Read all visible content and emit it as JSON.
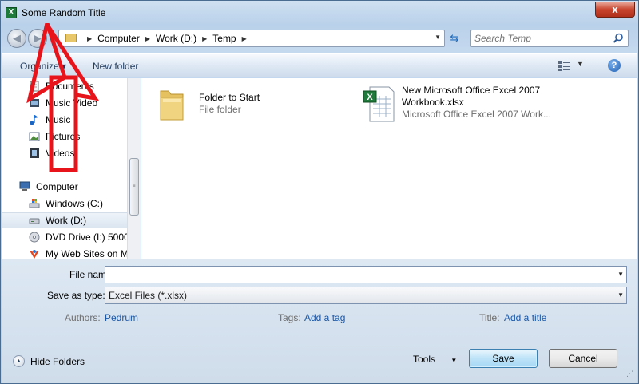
{
  "window": {
    "title": "Some Random Title",
    "close_glyph": "x"
  },
  "address": {
    "crumbs": [
      "Computer",
      "Work (D:)",
      "Temp"
    ],
    "search_placeholder": "Search Temp"
  },
  "toolbar": {
    "organize_label": "Organize ▾",
    "new_folder_label": "New folder",
    "help_glyph": "?"
  },
  "sidebar": {
    "items": [
      {
        "label": "Documents",
        "icon": "documents-icon"
      },
      {
        "label": "Music Video",
        "icon": "video-icon"
      },
      {
        "label": "Music",
        "icon": "music-icon"
      },
      {
        "label": "Pictures",
        "icon": "pictures-icon"
      },
      {
        "label": "Videos",
        "icon": "videos-icon"
      },
      {
        "label": "Computer",
        "icon": "computer-icon"
      },
      {
        "label": "Windows (C:)",
        "icon": "windows-drive-icon"
      },
      {
        "label": "Work (D:)",
        "icon": "drive-icon"
      },
      {
        "label": "DVD Drive (I:) 5000",
        "icon": "dvd-icon"
      },
      {
        "label": "My Web Sites on M",
        "icon": "web-sites-icon"
      }
    ],
    "selected": "Work (D:)"
  },
  "files": [
    {
      "name": "Folder to Start",
      "type": "File folder",
      "icon": "folder-icon"
    },
    {
      "name_line1": "New Microsoft Office Excel 2007",
      "name_line2": "Workbook.xlsx",
      "type": "Microsoft Office Excel 2007 Work...",
      "icon": "excel-file-icon"
    }
  ],
  "form": {
    "file_name_label": "File name:",
    "file_name_value": "",
    "save_type_label": "Save as type:",
    "save_type_value": "Excel Files (*.xlsx)",
    "authors_label": "Authors:",
    "authors_value": "Pedrum",
    "tags_label": "Tags:",
    "tags_value": "Add a tag",
    "title_label": "Title:",
    "title_value": "Add a title"
  },
  "footer": {
    "hide_folders_label": "Hide Folders",
    "tools_label": "Tools",
    "save_label": "Save",
    "cancel_label": "Cancel"
  },
  "colors": {
    "annotation": "#e8141c",
    "link": "#1a57a8",
    "accent": "#3c7fb1"
  }
}
